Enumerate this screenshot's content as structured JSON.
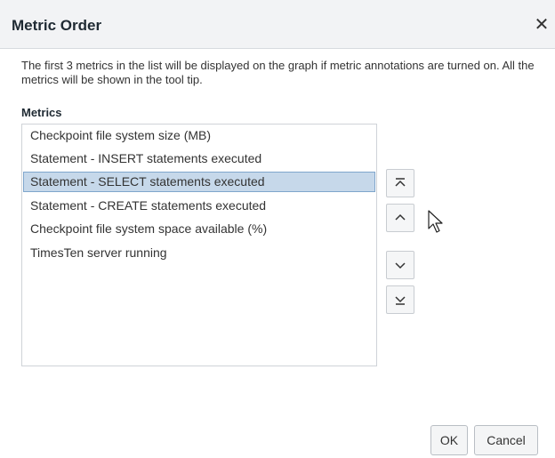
{
  "dialog": {
    "title": "Metric Order",
    "close_glyph": "✕",
    "description": "The first 3 metrics in the list will be displayed on the graph if metric annotations are turned on. All the metrics will be shown in the tool tip.",
    "list_label": "Metrics"
  },
  "metrics": [
    {
      "label": "Checkpoint file system size (MB)",
      "selected": false
    },
    {
      "label": "Statement - INSERT statements executed",
      "selected": false
    },
    {
      "label": "Statement - SELECT statements executed",
      "selected": true
    },
    {
      "label": "Statement - CREATE statements executed",
      "selected": false
    },
    {
      "label": "Checkpoint file system space available (%)",
      "selected": false
    },
    {
      "label": "TimesTen server running",
      "selected": false
    }
  ],
  "move_buttons": [
    {
      "icon": "move-to-top-icon"
    },
    {
      "icon": "move-up-icon"
    },
    {
      "icon": "move-down-icon"
    },
    {
      "icon": "move-to-bottom-icon"
    }
  ],
  "buttons": {
    "ok_label": "OK",
    "cancel_label": "Cancel"
  },
  "colors": {
    "titlebar_bg": "#f2f3f5",
    "selection_bg": "#c6d8ea",
    "selection_border": "#7fa6cc"
  }
}
